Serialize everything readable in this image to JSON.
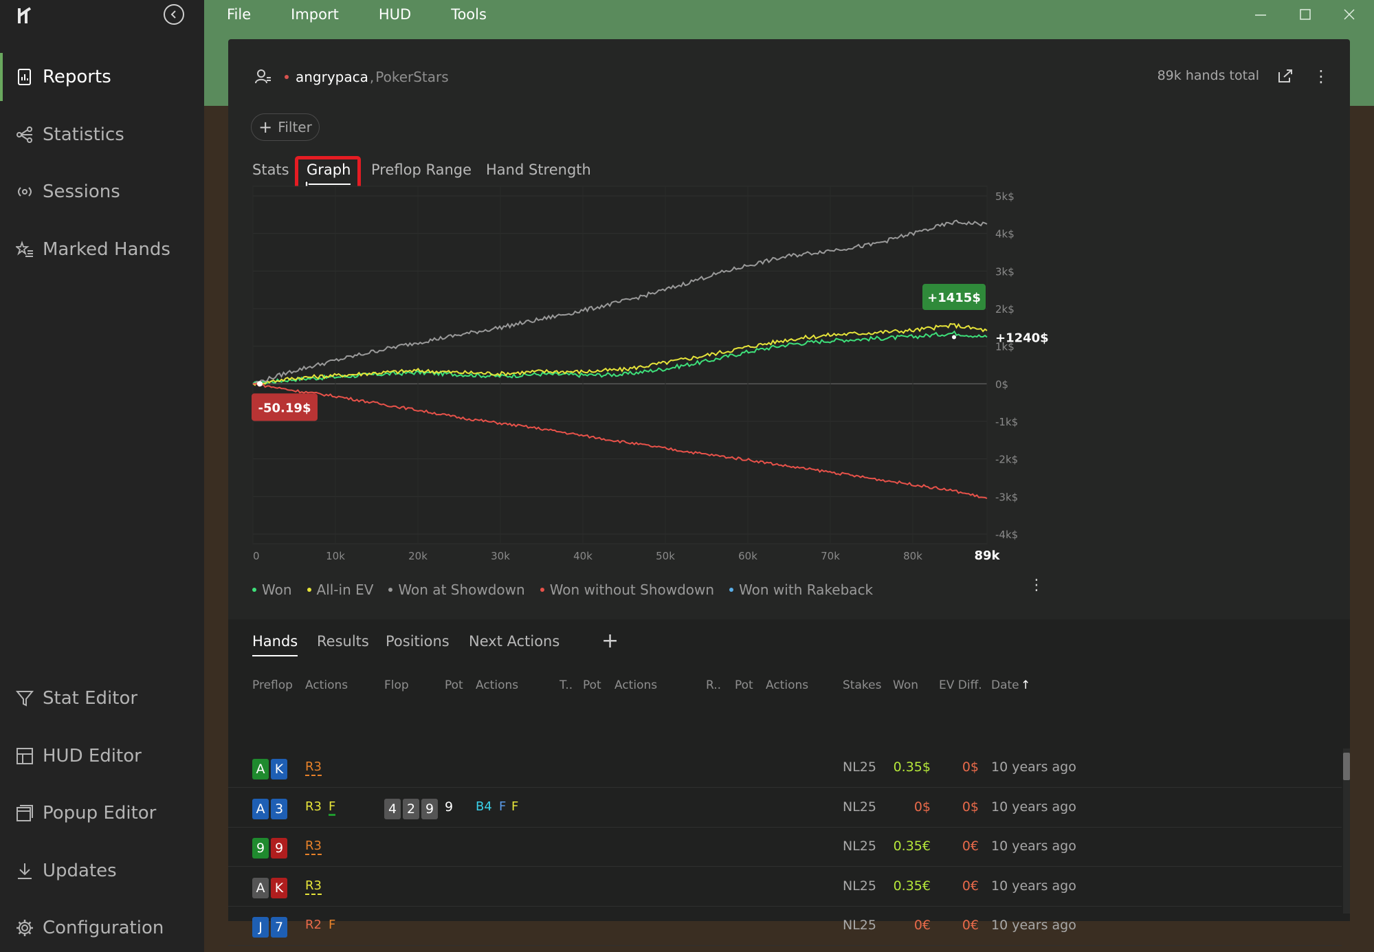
{
  "sidebar": {
    "top_items": [
      {
        "label": "Reports",
        "icon": "report-icon",
        "active": true
      },
      {
        "label": "Statistics",
        "icon": "share-nodes-icon",
        "active": false
      },
      {
        "label": "Sessions",
        "icon": "broadcast-icon",
        "active": false
      },
      {
        "label": "Marked Hands",
        "icon": "star-list-icon",
        "active": false
      }
    ],
    "bottom_items": [
      {
        "label": "Stat Editor",
        "icon": "funnel-icon"
      },
      {
        "label": "HUD Editor",
        "icon": "layout-icon"
      },
      {
        "label": "Popup Editor",
        "icon": "windows-icon"
      },
      {
        "label": "Updates",
        "icon": "download-icon"
      },
      {
        "label": "Configuration",
        "icon": "gear-icon"
      }
    ]
  },
  "menu": {
    "items": [
      "File",
      "Import",
      "HUD",
      "Tools"
    ]
  },
  "header": {
    "player": "angrypaca",
    "site": "PokerStars",
    "hands_total": "89k hands total"
  },
  "filter": {
    "label": "Filter"
  },
  "tabs": {
    "items": [
      "Stats",
      "Graph",
      "Preflop Range",
      "Hand Strength"
    ],
    "active": "Graph"
  },
  "chart_data": {
    "type": "line",
    "x_tick_labels": [
      "0",
      "10k",
      "20k",
      "30k",
      "40k",
      "50k",
      "60k",
      "70k",
      "80k",
      "89k"
    ],
    "y_tick_labels": [
      "5k$",
      "4k$",
      "3k$",
      "2k$",
      "1k$",
      "0$",
      "-1k$",
      "-2k$",
      "-3k$",
      "-4k$"
    ],
    "xlim": [
      0,
      89000
    ],
    "ylim": [
      -4000,
      5000
    ],
    "x": [
      0,
      5000,
      10000,
      15000,
      20000,
      25000,
      30000,
      35000,
      40000,
      45000,
      50000,
      55000,
      60000,
      65000,
      70000,
      75000,
      80000,
      85000,
      89000
    ],
    "series": [
      {
        "name": "Won",
        "color": "#3ee07a",
        "values": [
          0,
          120,
          180,
          250,
          300,
          250,
          200,
          260,
          230,
          250,
          400,
          600,
          850,
          1050,
          1150,
          1200,
          1250,
          1350,
          1240
        ]
      },
      {
        "name": "All-in EV",
        "color": "#e6e43a",
        "values": [
          0,
          150,
          220,
          290,
          350,
          300,
          270,
          330,
          320,
          380,
          560,
          760,
          980,
          1180,
          1300,
          1360,
          1420,
          1560,
          1415
        ]
      },
      {
        "name": "Won at Showdown",
        "color": "#9a9a9a",
        "values": [
          0,
          350,
          620,
          880,
          1100,
          1300,
          1500,
          1720,
          1950,
          2200,
          2500,
          2850,
          3150,
          3400,
          3550,
          3700,
          4000,
          4300,
          4250
        ]
      },
      {
        "name": "Won without Showdown",
        "color": "#e8524a",
        "values": [
          0,
          -180,
          -330,
          -520,
          -700,
          -900,
          -1050,
          -1200,
          -1380,
          -1550,
          -1720,
          -1880,
          -2020,
          -2200,
          -2350,
          -2520,
          -2680,
          -2850,
          -3050
        ]
      },
      {
        "name": "Won with Rakeback",
        "color": "#5aaee8",
        "values": []
      }
    ],
    "annotations": {
      "max_label": "+1415$",
      "end_label": "+1240$",
      "min_label": "-50.19$"
    },
    "grid": true,
    "legend": "bottom"
  },
  "hands": {
    "tabs": [
      "Hands",
      "Results",
      "Positions",
      "Next Actions"
    ],
    "active_tab": "Hands",
    "columns": [
      "Preflop",
      "Actions",
      "Flop",
      "Pot",
      "Actions",
      "T..",
      "Pot",
      "Actions",
      "R..",
      "Pot",
      "Actions",
      "Stakes",
      "Won",
      "EV Diff.",
      "Date"
    ],
    "sort_indicator": "↑",
    "rows": [
      {
        "cards": [
          {
            "r": "A",
            "c": "green"
          },
          {
            "r": "K",
            "c": "blue"
          }
        ],
        "preflop_actions": [
          {
            "t": "R3",
            "color": "#e8822a",
            "u": "dash"
          }
        ],
        "flop": [],
        "flop_actions": [],
        "stakes": "NL25",
        "won": "0.35$",
        "won_color": "#b6e83a",
        "ev_diff": "0$",
        "ev_color": "#e86a4a",
        "date": "10 years ago"
      },
      {
        "cards": [
          {
            "r": "A",
            "c": "blue"
          },
          {
            "r": "3",
            "c": "blue"
          }
        ],
        "preflop_actions": [
          {
            "t": "R3",
            "color": "#e6e43a",
            "u": ""
          },
          {
            "t": "F",
            "color": "#e6e43a",
            "u": "solid"
          }
        ],
        "flop": [
          {
            "r": "4",
            "c": "gray"
          },
          {
            "r": "2",
            "c": "gray"
          },
          {
            "r": "9",
            "c": "gray"
          }
        ],
        "flop_extra": "9",
        "flop_actions": [
          {
            "t": "B4",
            "color": "#3ad0e8"
          },
          {
            "t": "F",
            "color": "#5a9ae8"
          },
          {
            "t": "F",
            "color": "#e6e43a"
          }
        ],
        "stakes": "NL25",
        "won": "0$",
        "won_color": "#e86a4a",
        "ev_diff": "0$",
        "ev_color": "#e86a4a",
        "date": "10 years ago"
      },
      {
        "cards": [
          {
            "r": "9",
            "c": "green"
          },
          {
            "r": "9",
            "c": "red"
          }
        ],
        "preflop_actions": [
          {
            "t": "R3",
            "color": "#e8822a",
            "u": "dash"
          }
        ],
        "flop": [],
        "flop_actions": [],
        "stakes": "NL25",
        "won": "0.35€",
        "won_color": "#b6e83a",
        "ev_diff": "0€",
        "ev_color": "#e86a4a",
        "date": "10 years ago"
      },
      {
        "cards": [
          {
            "r": "A",
            "c": "gray"
          },
          {
            "r": "K",
            "c": "red"
          }
        ],
        "preflop_actions": [
          {
            "t": "R3",
            "color": "#e6e43a",
            "u": "dash"
          }
        ],
        "flop": [],
        "flop_actions": [],
        "stakes": "NL25",
        "won": "0.35€",
        "won_color": "#b6e83a",
        "ev_diff": "0€",
        "ev_color": "#e86a4a",
        "date": "10 years ago"
      },
      {
        "cards": [
          {
            "r": "J",
            "c": "blue"
          },
          {
            "r": "7",
            "c": "blue"
          }
        ],
        "preflop_actions": [
          {
            "t": "R2",
            "color": "#e86a4a",
            "u": ""
          },
          {
            "t": "F",
            "color": "#e8822a",
            "u": ""
          }
        ],
        "flop": [],
        "flop_actions": [],
        "stakes": "NL25",
        "won": "0€",
        "won_color": "#e86a4a",
        "ev_diff": "0€",
        "ev_color": "#e86a4a",
        "date": "10 years ago"
      }
    ]
  }
}
